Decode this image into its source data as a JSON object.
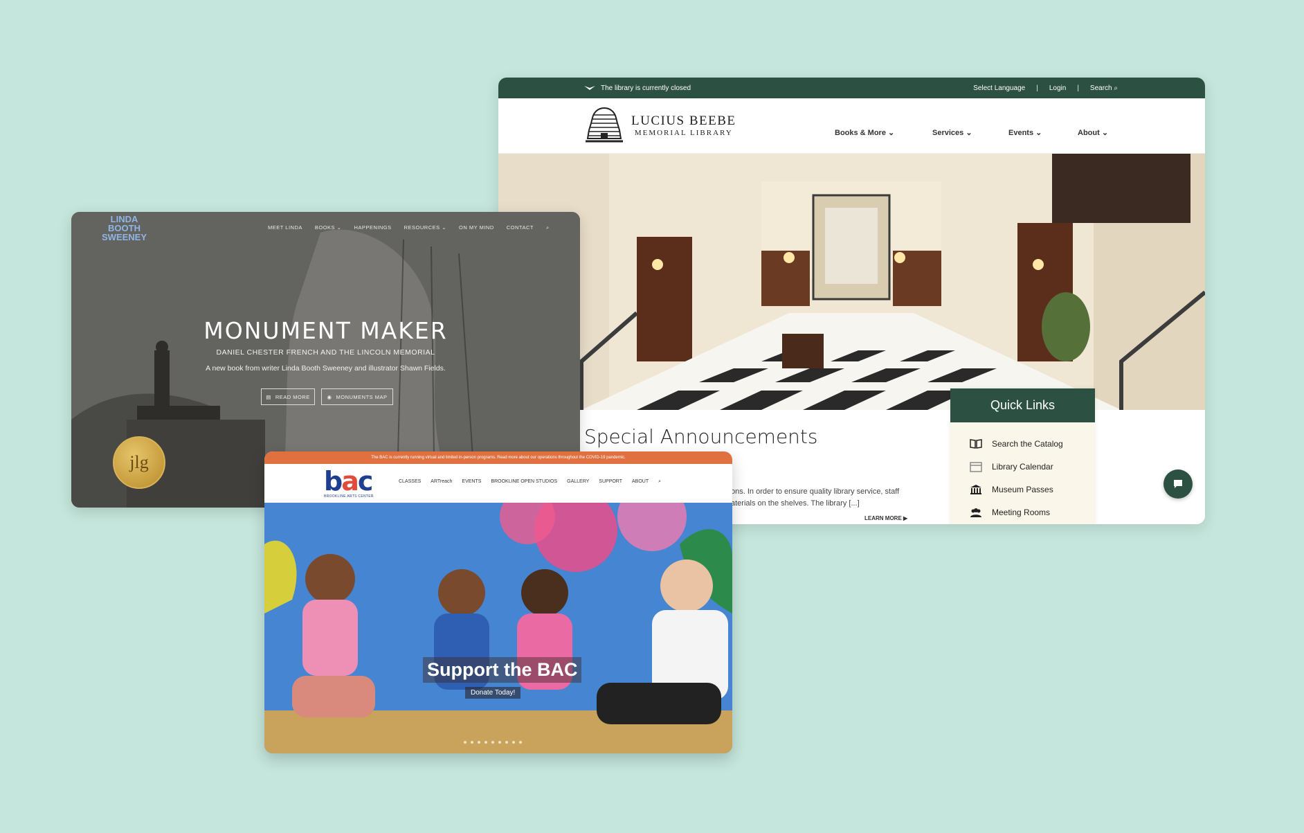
{
  "library": {
    "status_text": "The library is currently closed",
    "top_links": [
      "Select Language",
      "Login",
      "Search"
    ],
    "logo_line1": "LUCIUS BEEBE",
    "logo_line2": "MEMORIAL LIBRARY",
    "nav": [
      "Books & More",
      "Services",
      "Events",
      "About"
    ],
    "announcements_title": "Special Announcements",
    "announcement_line1": "ons. In order to ensure quality library service, staff",
    "announcement_line2": "aterials on the shelves. The library [...]",
    "learn_more": "LEARN MORE",
    "quick_links_title": "Quick Links",
    "quick_links": [
      {
        "label": "Search the Catalog",
        "icon": "book-icon"
      },
      {
        "label": "Library Calendar",
        "icon": "calendar-icon"
      },
      {
        "label": "Museum Passes",
        "icon": "museum-icon"
      },
      {
        "label": "Meeting Rooms",
        "icon": "people-icon"
      }
    ],
    "colors": {
      "brand": "#2c5143",
      "panel": "#fbf6ea"
    }
  },
  "linda": {
    "logo_lines": [
      "LINDA",
      "BOOTH",
      "SWEENEY"
    ],
    "nav": [
      "MEET LINDA",
      "BOOKS",
      "HAPPENINGS",
      "RESOURCES",
      "ON MY MIND",
      "CONTACT"
    ],
    "title": "MONUMENT MAKER",
    "subtitle": "DANIEL CHESTER FRENCH AND THE LINCOLN MEMORIAL",
    "description": "A new book from writer Linda Booth Sweeney and illustrator Shawn Fields.",
    "buttons": [
      "READ MORE",
      "MONUMENTS MAP"
    ],
    "seal_text": "jlg"
  },
  "bac": {
    "banner": "The BAC is currently running virtual and limited in-person programs. Read more about our operations throughout the COVID-19 pandemic.",
    "logo_b": "b",
    "logo_a": "a",
    "logo_c": "c",
    "tagline": "BROOKLINE ARTS CENTER",
    "nav": [
      "CLASSES",
      "ARTreach",
      "EVENTS",
      "BROOKLINE OPEN STUDIOS",
      "GALLERY",
      "SUPPORT",
      "ABOUT"
    ],
    "headline": "Support the BAC",
    "cta": "Donate Today!",
    "colors": {
      "banner": "#e07040",
      "logo_blue": "#1e3f8f"
    }
  }
}
